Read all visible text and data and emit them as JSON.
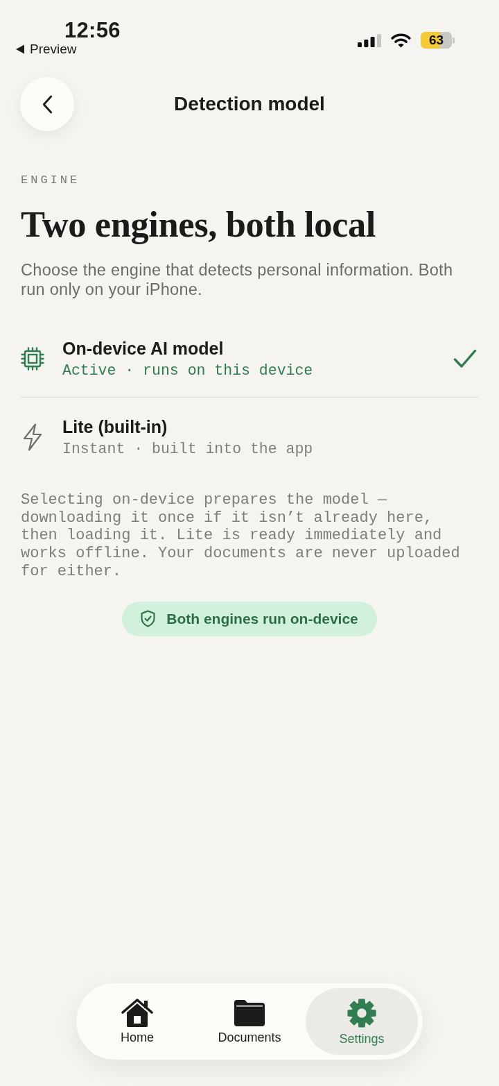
{
  "status_bar": {
    "time": "12:56",
    "back_label": "Preview",
    "battery": {
      "text": "63",
      "level": 0.63
    }
  },
  "header": {
    "title": "Detection model"
  },
  "section": {
    "eyebrow": "ENGINE",
    "heading": "Two engines, both local",
    "description": "Choose the engine that detects personal information. Both run only on your iPhone."
  },
  "engines": [
    {
      "title": "On-device AI model",
      "subtitle": "Active · runs on this device",
      "selected": true
    },
    {
      "title": "Lite (built-in)",
      "subtitle": "Instant · built into the app",
      "selected": false
    }
  ],
  "note": "Selecting on-device prepares the model — downloading it once if it isn’t already here, then loading it. Lite is ready immediately and works offline. Your documents are never uploaded for either.",
  "badge": {
    "label": "Both engines run on-device"
  },
  "tab_bar": {
    "tabs": [
      {
        "label": "Home",
        "selected": false
      },
      {
        "label": "Documents",
        "selected": false
      },
      {
        "label": "Settings",
        "selected": true
      }
    ]
  }
}
